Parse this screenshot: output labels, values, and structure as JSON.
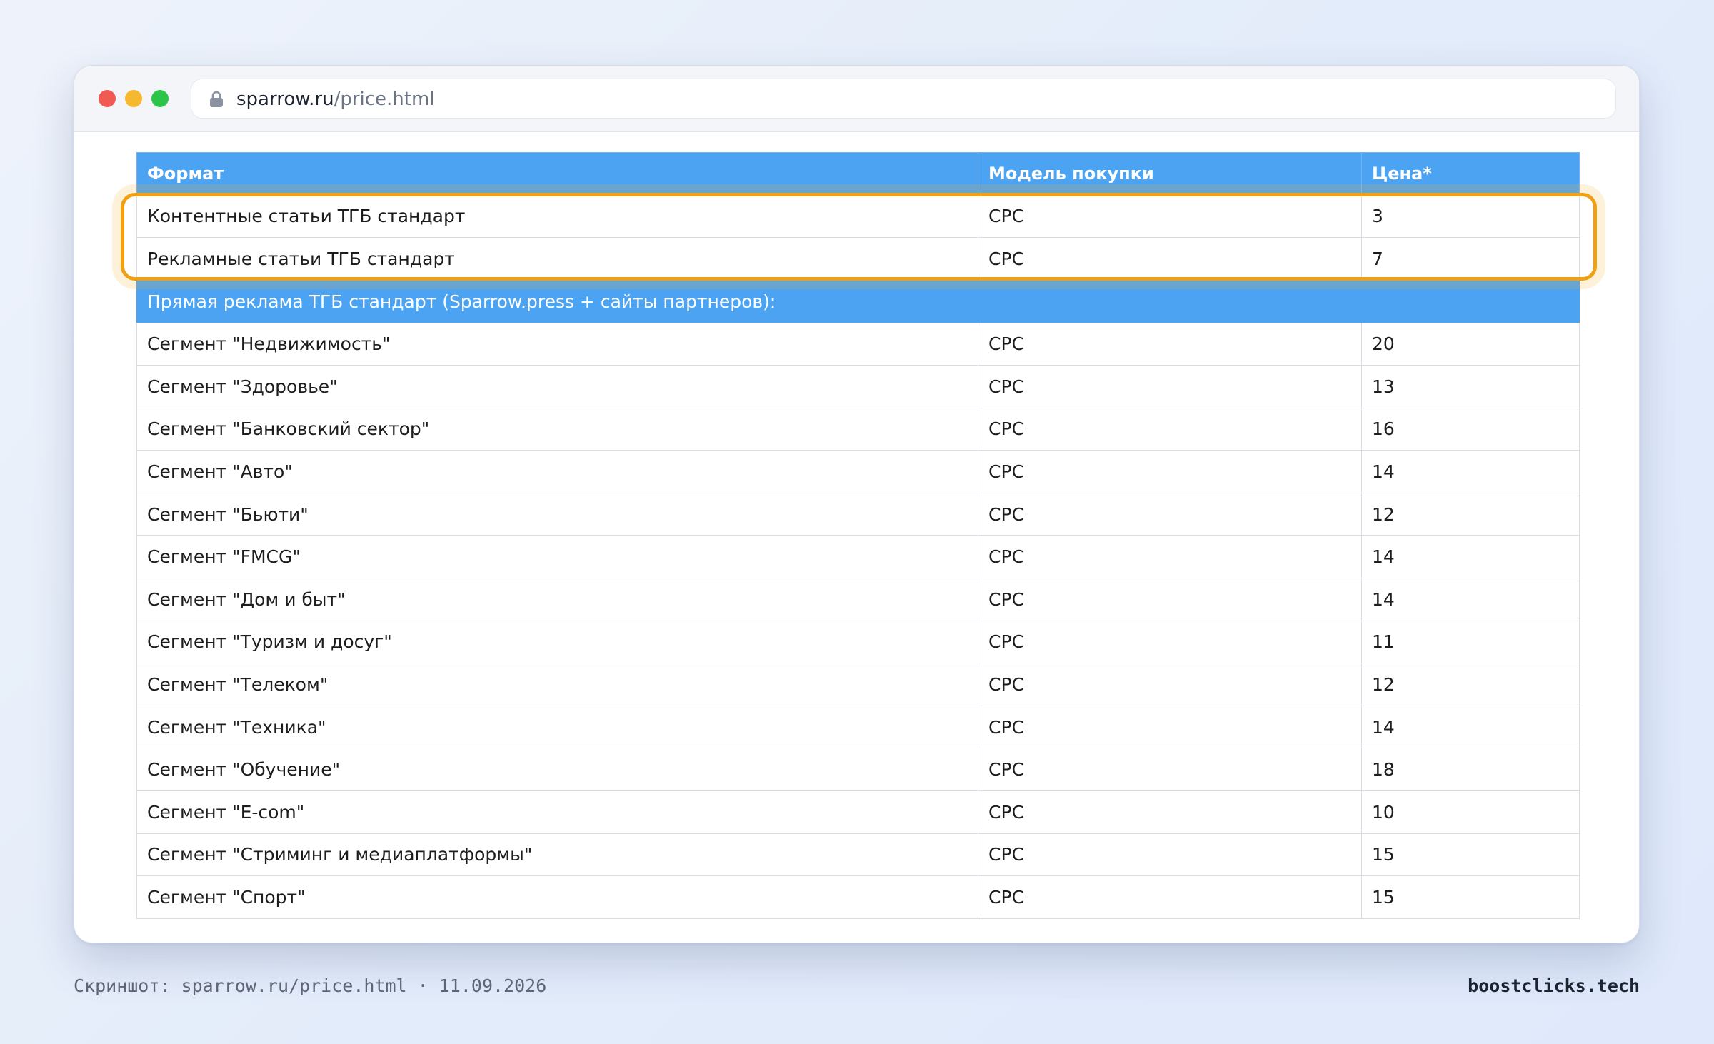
{
  "browser": {
    "url_domain": "sparrow.ru",
    "url_path": "/price.html",
    "lock_icon": "lock-icon"
  },
  "table": {
    "headers": [
      "Формат",
      "Модель покупки",
      "Цена*"
    ],
    "highlighted_rows": [
      {
        "format": "Контентные статьи ТГБ стандарт",
        "model": "CPC",
        "price": "3"
      },
      {
        "format": "Рекламные статьи ТГБ стандарт",
        "model": "CPC",
        "price": "7"
      }
    ],
    "section_title": "Прямая реклама ТГБ стандарт (Sparrow.press + сайты партнеров):",
    "segment_rows": [
      {
        "format": "Сегмент \"Недвижимость\"",
        "model": "CPC",
        "price": "20"
      },
      {
        "format": "Сегмент \"Здоровье\"",
        "model": "CPC",
        "price": "13"
      },
      {
        "format": "Сегмент \"Банковский сектор\"",
        "model": "CPC",
        "price": "16"
      },
      {
        "format": "Сегмент \"Авто\"",
        "model": "CPC",
        "price": "14"
      },
      {
        "format": "Сегмент \"Бьюти\"",
        "model": "CPC",
        "price": "12"
      },
      {
        "format": "Сегмент \"FMCG\"",
        "model": "CPC",
        "price": "14"
      },
      {
        "format": "Сегмент \"Дом и быт\"",
        "model": "CPC",
        "price": "14"
      },
      {
        "format": "Сегмент \"Туризм и досуг\"",
        "model": "CPC",
        "price": "11"
      },
      {
        "format": "Сегмент \"Телеком\"",
        "model": "CPC",
        "price": "12"
      },
      {
        "format": "Сегмент \"Техника\"",
        "model": "CPC",
        "price": "14"
      },
      {
        "format": "Сегмент \"Обучение\"",
        "model": "CPC",
        "price": "18"
      },
      {
        "format": "Сегмент \"E-com\"",
        "model": "CPC",
        "price": "10"
      },
      {
        "format": "Сегмент \"Стриминг и медиаплатформы\"",
        "model": "CPC",
        "price": "15"
      },
      {
        "format": "Сегмент \"Спорт\"",
        "model": "CPC",
        "price": "15"
      }
    ]
  },
  "footer": {
    "caption": "Скриншот: sparrow.ru/price.html · 11.09.2026",
    "brand": "boostclicks.tech"
  },
  "colors": {
    "header_blue": "#4ba3f2",
    "highlight_orange": "#f0a014"
  }
}
